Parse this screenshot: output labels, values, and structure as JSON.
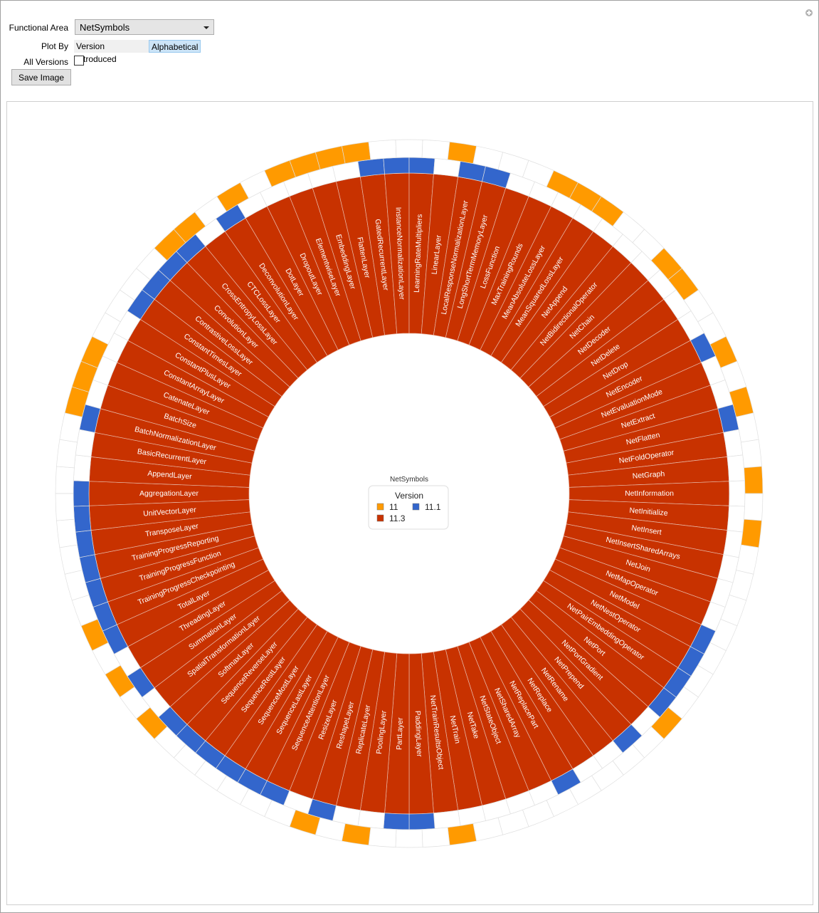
{
  "controls": {
    "functional_area_label": "Functional Area",
    "functional_area_value": "NetSymbols",
    "plot_by_label": "Plot By",
    "plot_by_options": [
      "Version Introduced",
      "Alphabetical"
    ],
    "plot_by_selected": "Alphabetical",
    "all_versions_label": "All Versions",
    "all_versions_checked": false,
    "save_image_label": "Save Image"
  },
  "chart_data": {
    "type": "radial-ring",
    "title": "NetSymbols",
    "legend": {
      "title": "Version",
      "placement": "center",
      "entries": [
        {
          "label": "11",
          "color": "#ff9a00"
        },
        {
          "label": "11.1",
          "color": "#3366cc"
        },
        {
          "label": "11.3",
          "color": "#c83200"
        }
      ]
    },
    "colors": {
      "v11": "#ff9a00",
      "v11_1": "#3366cc",
      "v11_3": "#c83200"
    },
    "symbols": [
      {
        "name": "AggregationLayer",
        "v11_1": true,
        "v11": false
      },
      {
        "name": "AppendLayer",
        "v11_1": false,
        "v11": false
      },
      {
        "name": "BasicRecurrentLayer",
        "v11_1": false,
        "v11": false
      },
      {
        "name": "BatchNormalizationLayer",
        "v11_1": true,
        "v11": true
      },
      {
        "name": "BatchSize",
        "v11_1": false,
        "v11": true
      },
      {
        "name": "CatenateLayer",
        "v11_1": false,
        "v11": true
      },
      {
        "name": "ConstantArrayLayer",
        "v11_1": false,
        "v11": false
      },
      {
        "name": "ConstantPlusLayer",
        "v11_1": false,
        "v11": false
      },
      {
        "name": "ConstantTimesLayer",
        "v11_1": true,
        "v11": false
      },
      {
        "name": "ContrastiveLossLayer",
        "v11_1": true,
        "v11": false
      },
      {
        "name": "ConvolutionLayer",
        "v11_1": true,
        "v11": true
      },
      {
        "name": "CrossEntropyLossLayer",
        "v11_1": true,
        "v11": true
      },
      {
        "name": "CTCLossLayer",
        "v11_1": false,
        "v11": false
      },
      {
        "name": "DeconvolutionLayer",
        "v11_1": true,
        "v11": true
      },
      {
        "name": "DotLayer",
        "v11_1": false,
        "v11": false
      },
      {
        "name": "DropoutLayer",
        "v11_1": false,
        "v11": true
      },
      {
        "name": "ElementwiseLayer",
        "v11_1": false,
        "v11": true
      },
      {
        "name": "EmbeddingLayer",
        "v11_1": false,
        "v11": true
      },
      {
        "name": "FlattenLayer",
        "v11_1": false,
        "v11": true
      },
      {
        "name": "GatedRecurrentLayer",
        "v11_1": true,
        "v11": false
      },
      {
        "name": "InstanceNormalizationLayer",
        "v11_1": true,
        "v11": false
      },
      {
        "name": "LearningRateMultipliers",
        "v11_1": true,
        "v11": false
      },
      {
        "name": "LinearLayer",
        "v11_1": false,
        "v11": true
      },
      {
        "name": "LocalResponseNormalizationLayer",
        "v11_1": true,
        "v11": false
      },
      {
        "name": "LongShortTermMemoryLayer",
        "v11_1": true,
        "v11": false
      },
      {
        "name": "LossFunction",
        "v11_1": false,
        "v11": false
      },
      {
        "name": "MaxTrainingRounds",
        "v11_1": false,
        "v11": true
      },
      {
        "name": "MeanAbsoluteLossLayer",
        "v11_1": false,
        "v11": true
      },
      {
        "name": "MeanSquaredLossLayer",
        "v11_1": false,
        "v11": true
      },
      {
        "name": "NetAppend",
        "v11_1": false,
        "v11": false
      },
      {
        "name": "NetBidirectionalOperator",
        "v11_1": false,
        "v11": false
      },
      {
        "name": "NetChain",
        "v11_1": false,
        "v11": true
      },
      {
        "name": "NetDecoder",
        "v11_1": false,
        "v11": true
      },
      {
        "name": "NetDelete",
        "v11_1": false,
        "v11": false
      },
      {
        "name": "NetDrop",
        "v11_1": false,
        "v11": false
      },
      {
        "name": "NetEncoder",
        "v11_1": true,
        "v11": true
      },
      {
        "name": "NetEvaluationMode",
        "v11_1": false,
        "v11": false
      },
      {
        "name": "NetExtract",
        "v11_1": false,
        "v11": true
      },
      {
        "name": "NetFlatten",
        "v11_1": true,
        "v11": false
      },
      {
        "name": "NetFoldOperator",
        "v11_1": false,
        "v11": false
      },
      {
        "name": "NetGraph",
        "v11_1": false,
        "v11": true
      },
      {
        "name": "NetInformation",
        "v11_1": false,
        "v11": false
      },
      {
        "name": "NetInitialize",
        "v11_1": false,
        "v11": true
      },
      {
        "name": "NetInsert",
        "v11_1": false,
        "v11": false
      },
      {
        "name": "NetInsertSharedArrays",
        "v11_1": false,
        "v11": false
      },
      {
        "name": "NetJoin",
        "v11_1": false,
        "v11": false
      },
      {
        "name": "NetMapOperator",
        "v11_1": false,
        "v11": false
      },
      {
        "name": "NetModel",
        "v11_1": true,
        "v11": false
      },
      {
        "name": "NetNestOperator",
        "v11_1": true,
        "v11": false
      },
      {
        "name": "NetPairEmbeddingOperator",
        "v11_1": true,
        "v11": false
      },
      {
        "name": "NetPort",
        "v11_1": true,
        "v11": true
      },
      {
        "name": "NetPortGradient",
        "v11_1": false,
        "v11": false
      },
      {
        "name": "NetPrepend",
        "v11_1": true,
        "v11": false
      },
      {
        "name": "NetRename",
        "v11_1": false,
        "v11": false
      },
      {
        "name": "NetReplace",
        "v11_1": false,
        "v11": false
      },
      {
        "name": "NetReplacePart",
        "v11_1": true,
        "v11": false
      },
      {
        "name": "NetSharedArray",
        "v11_1": false,
        "v11": false
      },
      {
        "name": "NetStateObject",
        "v11_1": false,
        "v11": false
      },
      {
        "name": "NetTake",
        "v11_1": false,
        "v11": false
      },
      {
        "name": "NetTrain",
        "v11_1": false,
        "v11": true
      },
      {
        "name": "NetTrainResultsObject",
        "v11_1": false,
        "v11": false
      },
      {
        "name": "PaddingLayer",
        "v11_1": true,
        "v11": false
      },
      {
        "name": "PartLayer",
        "v11_1": true,
        "v11": false
      },
      {
        "name": "PoolingLayer",
        "v11_1": false,
        "v11": true
      },
      {
        "name": "ReplicateLayer",
        "v11_1": false,
        "v11": false
      },
      {
        "name": "ReshapeLayer",
        "v11_1": true,
        "v11": true
      },
      {
        "name": "ResizeLayer",
        "v11_1": false,
        "v11": false
      },
      {
        "name": "SequenceAttentionLayer",
        "v11_1": true,
        "v11": false
      },
      {
        "name": "SequenceLastLayer",
        "v11_1": true,
        "v11": false
      },
      {
        "name": "SequenceMostLayer",
        "v11_1": true,
        "v11": false
      },
      {
        "name": "SequenceRestLayer",
        "v11_1": true,
        "v11": false
      },
      {
        "name": "SequenceReverseLayer",
        "v11_1": true,
        "v11": false
      },
      {
        "name": "SoftmaxLayer",
        "v11_1": true,
        "v11": true
      },
      {
        "name": "SpatialTransformationLayer",
        "v11_1": false,
        "v11": false
      },
      {
        "name": "SummationLayer",
        "v11_1": true,
        "v11": true
      },
      {
        "name": "ThreadingLayer",
        "v11_1": false,
        "v11": false
      },
      {
        "name": "TotalLayer",
        "v11_1": true,
        "v11": true
      },
      {
        "name": "TrainingProgressCheckpointing",
        "v11_1": true,
        "v11": false
      },
      {
        "name": "TrainingProgressFunction",
        "v11_1": true,
        "v11": false
      },
      {
        "name": "TrainingProgressReporting",
        "v11_1": true,
        "v11": false
      },
      {
        "name": "TransposeLayer",
        "v11_1": true,
        "v11": false
      },
      {
        "name": "UnitVectorLayer",
        "v11_1": true,
        "v11": false
      }
    ]
  }
}
